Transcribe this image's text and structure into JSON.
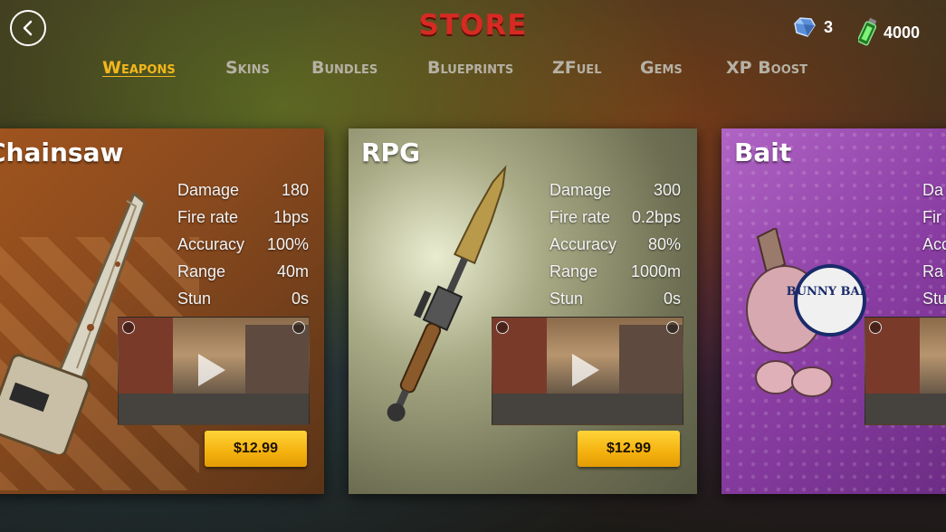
{
  "header": {
    "title": "STORE",
    "back_icon": "back-arrow-icon",
    "gems": {
      "icon": "gem-icon",
      "value": "3"
    },
    "fuel": {
      "icon": "fuel-canister-icon",
      "value": "4000"
    }
  },
  "tabs": [
    {
      "label": "Weapons",
      "active": true
    },
    {
      "label": "Skins",
      "active": false
    },
    {
      "label": "Bundles",
      "active": false
    },
    {
      "label": "Blueprints",
      "active": false
    },
    {
      "label": "ZFuel",
      "active": false
    },
    {
      "label": "Gems",
      "active": false
    },
    {
      "label": "XP Boost",
      "active": false
    }
  ],
  "items": [
    {
      "name": "Chainsaw",
      "stats": [
        {
          "label": "Damage",
          "value": "180"
        },
        {
          "label": "Fire rate",
          "value": "1bps"
        },
        {
          "label": "Accuracy",
          "value": "100%"
        },
        {
          "label": "Range",
          "value": "40m"
        },
        {
          "label": "Stun",
          "value": "0s"
        }
      ],
      "price": "$12.99"
    },
    {
      "name": "RPG",
      "stats": [
        {
          "label": "Damage",
          "value": "300"
        },
        {
          "label": "Fire rate",
          "value": "0.2bps"
        },
        {
          "label": "Accuracy",
          "value": "80%"
        },
        {
          "label": "Range",
          "value": "1000m"
        },
        {
          "label": "Stun",
          "value": "0s"
        }
      ],
      "price": "$12.99"
    },
    {
      "name": "Bait",
      "stats": [
        {
          "label": "Da"
        },
        {
          "label": "Fir"
        },
        {
          "label": "Acc"
        },
        {
          "label": "Ra"
        },
        {
          "label": "Stu"
        }
      ],
      "drum_text": "BUNNY BAIT"
    }
  ],
  "colors": {
    "title_red": "#d62a22",
    "tab_active": "#f3b71b",
    "tab_inactive": "#b6b1a4",
    "price_button": "#f4b10e"
  }
}
